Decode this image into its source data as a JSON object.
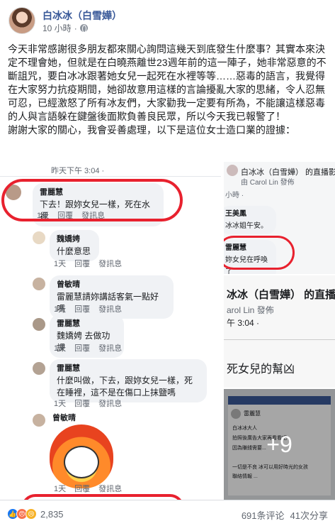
{
  "post": {
    "author": "白冰冰（白雪嬅）",
    "time": "10 小時",
    "separator": "·",
    "privacy_icon": "globe-icon",
    "text": "今天非常感謝很多朋友都來關心詢問這幾天到底發生什麼事？其實本來決定不理會她，但就是在白曉燕離世23週年前的這一陣子，她非常惡意的不斷詛咒，要白冰冰跟著她女兒一起死在水裡等等……惡毒的語言，我覺得在大家努力抗疫期間，她卻故意用這樣的言論擾亂大家的思緒，令人忍無可忍，已經激怒了所有冰友們，大家勸我一定要有所為，不能讓這樣惡毒的人與言語躲在鍵盤後面欺負善良民眾，所以今天我已報警了！\n謝謝大家的關心，我會妥善處理，以下是這位女士造口業的證據："
  },
  "main_image": {
    "top_time": "昨天下午 3:04 ·",
    "comments": [
      {
        "name": "雷麗慧",
        "text": "下去！跟妳女兒一樣，死在水裡",
        "actions": [
          "1天",
          "回覆",
          "發訊息"
        ]
      },
      {
        "name": "魏嬌娉",
        "text": "什麼意思",
        "actions": [
          "1天",
          "回覆",
          "發訊息"
        ]
      },
      {
        "name": "曾敏晴",
        "text": "雷麗慧請妳講話客氣一點好嗎",
        "actions": [
          "1天",
          "回覆",
          "發訊息"
        ]
      },
      {
        "name": "雷麗慧",
        "text": "魏嬌娉 去做功課",
        "actions": [
          "1天",
          "回覆",
          "發訊息"
        ]
      },
      {
        "name": "雷麗慧",
        "text": "什麼叫做，下去，跟妳女兒一樣，死在睡裡，這不是在傷口上抹鹽嗎",
        "actions": [
          "1天",
          "回覆",
          "發訊息"
        ]
      },
      {
        "name": "曾敏晴",
        "text": "",
        "actions": [
          "1天",
          "回覆",
          "發訊息"
        ]
      }
    ]
  },
  "right_top": {
    "title": "白冰冰（白雪嬅） 的直播影片",
    "by": "由 Carol Lin 發佈",
    "time": "小時 ·",
    "comment1_name": "王美鳳",
    "comment1_text": "冰冰姐午安。",
    "comment2_name": "雷麗慧",
    "comment2_text": "妳女兒在呼喚了"
  },
  "right_mid": {
    "title": "冰冰（白雪嬅） 的直播影片",
    "by": "arol Lin 發佈",
    "time": "午 3:04 ·",
    "text": "死女兒的幫凶"
  },
  "right_bot": {
    "name": "雷麗慧",
    "more_count": "+9",
    "line1": "白冰冰大人",
    "line2": "拍照後廣告大家再看看吧",
    "line3": "因為賺錢需要...",
    "line4": "一切是不良 冰可以用好時光的女孩",
    "line5": "聯絡情報 ..."
  },
  "footer": {
    "reaction_count": "2,835",
    "comments": "691条评论",
    "shares": "41次分享"
  }
}
